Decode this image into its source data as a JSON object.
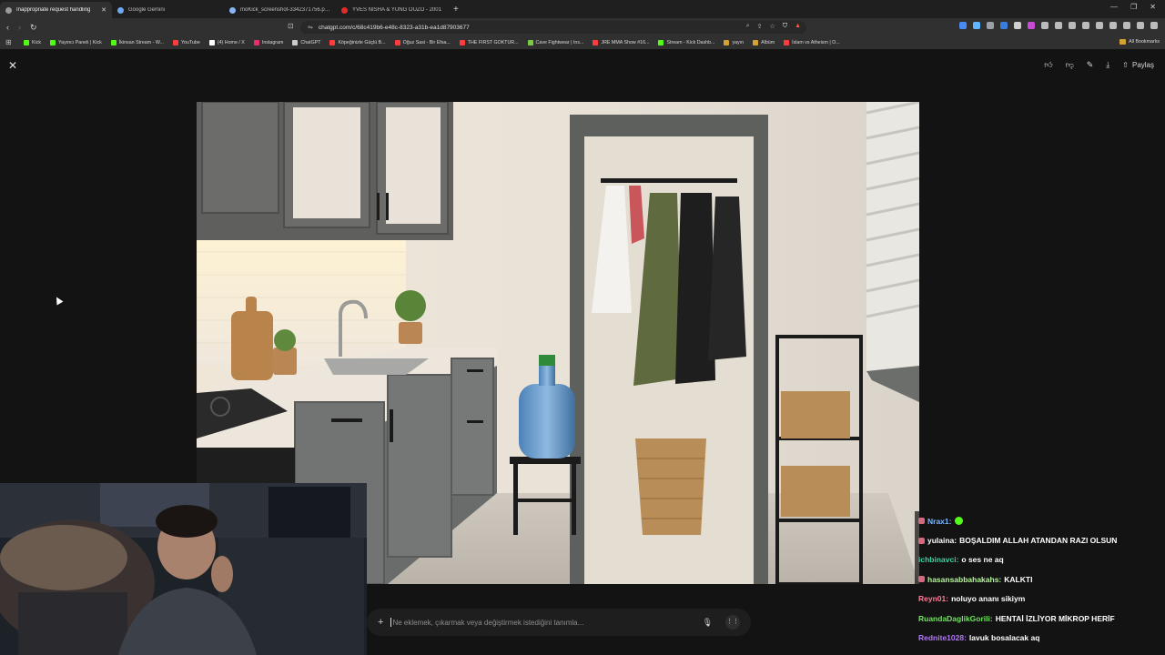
{
  "tabs": [
    {
      "title": "Inappropriate request handling",
      "active": true,
      "favicon_color": "#9a9a9a"
    },
    {
      "title": "Google Gemini",
      "active": false,
      "favicon_color": "#6fa8f5"
    },
    {
      "title": "moKick_screenshot-3342371756.png",
      "active": false,
      "favicon_color": "#8ab4f8"
    },
    {
      "title": "YVES NISHA & YUNG OUZO - 2001",
      "active": false,
      "favicon_color": "#e02b2b"
    }
  ],
  "toolbar": {
    "url": "chatgpt.com/c/68c419b6-e48c-8323-a31b-ea1d87903677"
  },
  "bookmarks": [
    {
      "label": "Kick",
      "color": "#53fc18"
    },
    {
      "label": "Yayıncı Paneli | Kick",
      "color": "#53fc18"
    },
    {
      "label": "İkinsan Stream - W...",
      "color": "#53fc18"
    },
    {
      "label": "YouTube",
      "color": "#ff3b3b"
    },
    {
      "label": "(4) Home / X",
      "color": "#ffffff"
    },
    {
      "label": "Instagram",
      "color": "#e1306c"
    },
    {
      "label": "ChatGPT",
      "color": "#cccccc"
    },
    {
      "label": "Köpeğinizle Güçlü B...",
      "color": "#ff3b3b"
    },
    {
      "label": "Oğuz Sasi - Bir Efsa...",
      "color": "#ff3b3b"
    },
    {
      "label": "THE FIRST GOKTUR...",
      "color": "#ff3b3b"
    },
    {
      "label": "Cave Fightwear | Ins...",
      "color": "#7cc943"
    },
    {
      "label": "JRE MMA Show #16...",
      "color": "#ff3b3b"
    },
    {
      "label": "Stream - Kick Dashb...",
      "color": "#53fc18"
    },
    {
      "label": "yayın",
      "color": "#d4a233"
    },
    {
      "label": "Albüm",
      "color": "#d4a233"
    },
    {
      "label": "İslam vs Atheism | O...",
      "color": "#ff3b3b"
    }
  ],
  "all_bookmarks_label": "All Bookmarks",
  "viewer": {
    "share_label": "Paylaş",
    "prompt_placeholder": "Ne eklemek, çıkarmak veya değiştirmek istediğini tanımla..."
  },
  "chat": [
    {
      "user": "Nrax1:",
      "text": "",
      "color": "#7fb6ff",
      "badge": true,
      "emote": true
    },
    {
      "user": "yulaina:",
      "text": "BOŞALDIM ALLAH ATANDAN RAZI OLSUN",
      "color": "#ffffff",
      "badge": true,
      "emote": false
    },
    {
      "user": "ichbinavci:",
      "text": "o ses ne aq",
      "color": "#3fd1a6",
      "badge": false,
      "emote": false
    },
    {
      "user": "hasansabbahakahs:",
      "text": "KALKTI",
      "color": "#b6f59a",
      "badge": true,
      "emote": false
    },
    {
      "user": "Reyn01:",
      "text": "noluyo ananı sikiym",
      "color": "#ff7a95",
      "badge": false,
      "emote": false
    },
    {
      "user": "RuandaDaglikGorili:",
      "text": "HENTAİ İZLİYOR MİKROP HERİF",
      "color": "#6ee35c",
      "badge": false,
      "emote": false
    },
    {
      "user": "Rednite1028:",
      "text": "lavuk bosalacak aq",
      "color": "#b079f5",
      "badge": false,
      "emote": false
    }
  ]
}
